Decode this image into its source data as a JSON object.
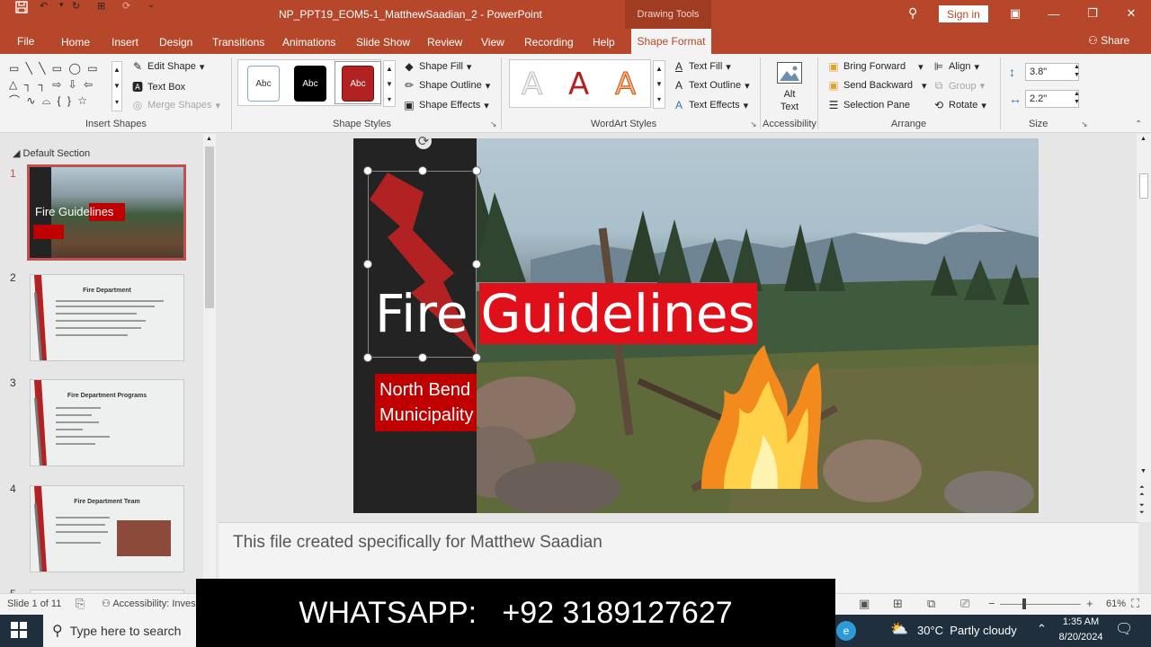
{
  "window": {
    "title": "NP_PPT19_EOM5-1_MatthewSaadian_2  -  PowerPoint",
    "contextual_tab_group": "Drawing Tools",
    "sign_in": "Sign in",
    "share": "Share"
  },
  "tabs": [
    "File",
    "Home",
    "Insert",
    "Design",
    "Transitions",
    "Animations",
    "Slide Show",
    "Review",
    "View",
    "Recording",
    "Help"
  ],
  "active_tab": "Shape Format",
  "ribbon": {
    "insert_shapes": {
      "label": "Insert Shapes",
      "edit_shape": "Edit Shape",
      "text_box": "Text Box",
      "merge_shapes": "Merge Shapes"
    },
    "shape_styles": {
      "label": "Shape Styles",
      "presets": [
        "Abc",
        "Abc",
        "Abc"
      ],
      "shape_fill": "Shape Fill",
      "shape_outline": "Shape Outline",
      "shape_effects": "Shape Effects"
    },
    "wordart_styles": {
      "label": "WordArt Styles",
      "letters": [
        "A",
        "A",
        "A"
      ],
      "text_fill": "Text Fill",
      "text_outline": "Text Outline",
      "text_effects": "Text Effects"
    },
    "accessibility": {
      "label": "Accessibility",
      "alt_text": "Alt Text"
    },
    "arrange": {
      "label": "Arrange",
      "bring_forward": "Bring Forward",
      "send_backward": "Send Backward",
      "selection_pane": "Selection Pane",
      "align": "Align",
      "group": "Group",
      "rotate": "Rotate"
    },
    "size": {
      "label": "Size",
      "height": "3.8\"",
      "width": "2.2\""
    }
  },
  "slides_pane": {
    "section": "Default Section",
    "slides": [
      {
        "num": "1",
        "title": "Fire Guidelines"
      },
      {
        "num": "2",
        "title": "Fire Department"
      },
      {
        "num": "3",
        "title": "Fire Department Programs"
      },
      {
        "num": "4",
        "title": "Fire Department Team"
      },
      {
        "num": "5",
        "title": ""
      }
    ]
  },
  "slide": {
    "title_left": "Fire",
    "title_right": "Guidelines",
    "subtitle_line1": "North Bend",
    "subtitle_line2": "Municipality"
  },
  "notes": "This file created specifically for Matthew Saadian",
  "status": {
    "slide_of": "Slide 1 of 11",
    "accessibility": "Accessibility: Inves",
    "zoom": "61%"
  },
  "taskbar": {
    "search_placeholder": "Type here to search",
    "weather": "30°C  Partly cloudy",
    "time": "1:35 AM",
    "date": "8/20/2024"
  },
  "banner": "WHATSAPP:   +92 3189127627",
  "colors": {
    "accent": "#b7472a",
    "slide_red": "#c00000",
    "slide_dark": "#232323"
  }
}
